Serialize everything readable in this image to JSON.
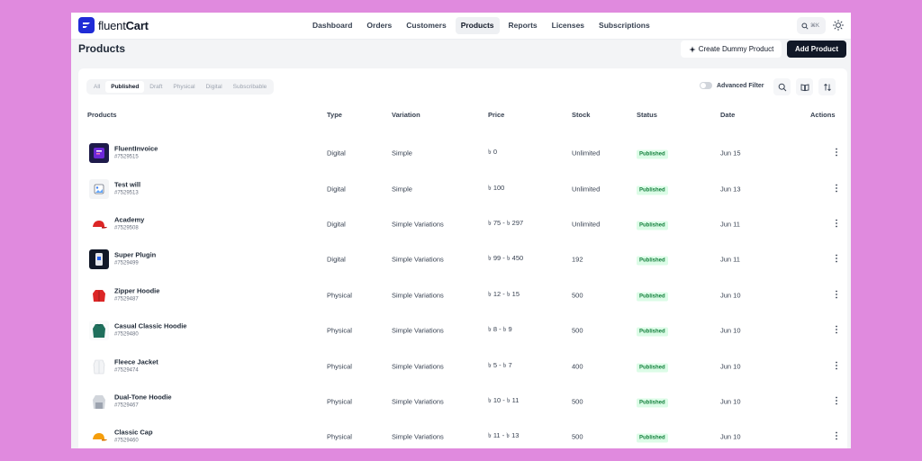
{
  "app": {
    "logo_light": "fluent",
    "logo_bold": "Cart"
  },
  "nav": {
    "items": [
      "Dashboard",
      "Orders",
      "Customers",
      "Products",
      "Reports",
      "Licenses",
      "Subscriptions"
    ],
    "active": "Products",
    "search_shortcut": "⌘K"
  },
  "page": {
    "title": "Products",
    "dummy_button": "Create Dummy Product",
    "add_button": "Add Product"
  },
  "filters": {
    "tabs": [
      "All",
      "Published",
      "Draft",
      "Physical",
      "Digital",
      "Subscribable"
    ],
    "active_tab": "Published",
    "advanced_filter_label": "Advanced Filter",
    "advanced_filter_on": false
  },
  "table": {
    "headers": {
      "products": "Products",
      "type": "Type",
      "variation": "Variation",
      "price": "Price",
      "stock": "Stock",
      "status": "Status",
      "date": "Date",
      "actions": "Actions"
    },
    "rows": [
      {
        "name": "FluentInvoice",
        "id": "#7529515",
        "type": "Digital",
        "variation": "Simple",
        "price": "৳ 0",
        "stock": "Unlimited",
        "status": "Published",
        "date": "Jun 15",
        "thumb": "invoice-app-thumbnail"
      },
      {
        "name": "Test will",
        "id": "#7529513",
        "type": "Digital",
        "variation": "Simple",
        "price": "৳ 100",
        "stock": "Unlimited",
        "status": "Published",
        "date": "Jun 13",
        "thumb": "image-placeholder-thumbnail"
      },
      {
        "name": "Academy",
        "id": "#7529508",
        "type": "Digital",
        "variation": "Simple Variations",
        "price": "৳ 75 - ৳ 297",
        "stock": "Unlimited",
        "status": "Published",
        "date": "Jun 11",
        "thumb": "red-cap-thumbnail"
      },
      {
        "name": "Super Plugin",
        "id": "#7529499",
        "type": "Digital",
        "variation": "Simple Variations",
        "price": "৳ 99 - ৳ 450",
        "stock": "192",
        "status": "Published",
        "date": "Jun 11",
        "thumb": "plugin-box-thumbnail"
      },
      {
        "name": "Zipper Hoodie",
        "id": "#7529487",
        "type": "Physical",
        "variation": "Simple Variations",
        "price": "৳ 12 - ৳ 15",
        "stock": "500",
        "status": "Published",
        "date": "Jun 10",
        "thumb": "red-hoodie-thumbnail"
      },
      {
        "name": "Casual Classic Hoodie",
        "id": "#7529480",
        "type": "Physical",
        "variation": "Simple Variations",
        "price": "৳ 8 - ৳ 9",
        "stock": "500",
        "status": "Published",
        "date": "Jun 10",
        "thumb": "green-hoodie-thumbnail"
      },
      {
        "name": "Fleece Jacket",
        "id": "#7529474",
        "type": "Physical",
        "variation": "Simple Variations",
        "price": "৳ 5 - ৳ 7",
        "stock": "400",
        "status": "Published",
        "date": "Jun 10",
        "thumb": "white-jacket-thumbnail"
      },
      {
        "name": "Dual-Tone Hoodie",
        "id": "#7529467",
        "type": "Physical",
        "variation": "Simple Variations",
        "price": "৳ 10 - ৳ 11",
        "stock": "500",
        "status": "Published",
        "date": "Jun 10",
        "thumb": "grey-hoodie-thumbnail"
      },
      {
        "name": "Classic Cap",
        "id": "#7529460",
        "type": "Physical",
        "variation": "Simple Variations",
        "price": "৳ 11 - ৳ 13",
        "stock": "500",
        "status": "Published",
        "date": "Jun 10",
        "thumb": "orange-cap-thumbnail"
      }
    ]
  },
  "colors": {
    "background": "#e08ade",
    "brand": "#1f2bd6",
    "primary_button": "#111827",
    "badge_bg": "#dcfce7",
    "badge_text": "#15803d"
  }
}
